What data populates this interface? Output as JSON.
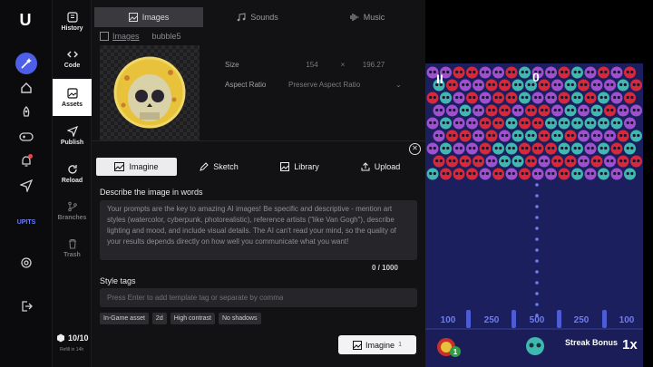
{
  "app": {
    "logo_text": "U"
  },
  "rail": {
    "items": [
      "magic-wand",
      "home",
      "rocket",
      "gamepad",
      "bell",
      "send",
      "settings",
      "logout"
    ],
    "upits_label": "UPITS"
  },
  "tools": [
    {
      "label": "History",
      "icon": "history-icon"
    },
    {
      "label": "Code",
      "icon": "code-icon"
    },
    {
      "label": "Assets",
      "icon": "image-icon",
      "active": true
    },
    {
      "label": "Publish",
      "icon": "send-icon"
    },
    {
      "label": "Reload",
      "icon": "reload-icon"
    },
    {
      "label": "Branches",
      "icon": "branch-icon"
    },
    {
      "label": "Trash",
      "icon": "trash-icon"
    }
  ],
  "credits": {
    "value": "10/10",
    "refill": "Refill in 14h"
  },
  "asset_panel": {
    "tabs": [
      {
        "label": "Images",
        "active": true
      },
      {
        "label": "Sounds"
      },
      {
        "label": "Music"
      }
    ],
    "breadcrumb": {
      "parent": "Images",
      "current": "bubble5"
    },
    "size_label": "Size",
    "width": "154",
    "times": "×",
    "height": "196.27",
    "aspect_label": "Aspect Ratio",
    "aspect_value": "Preserve Aspect Ratio"
  },
  "modal": {
    "tabs": [
      {
        "label": "Imagine",
        "active": true
      },
      {
        "label": "Sketch"
      },
      {
        "label": "Library"
      },
      {
        "label": "Upload"
      }
    ],
    "describe_label": "Describe the image in words",
    "describe_placeholder": "Your prompts are the key to amazing AI images! Be specific and descriptive - mention art styles (watercolor, cyberpunk, photorealistic), reference artists (\"like Van Gogh\"), describe lighting and mood, and include visual details. The AI can't read your mind, so the quality of your results depends directly on how well you communicate what you want!",
    "counter": "0 / 1000",
    "style_label": "Style tags",
    "tags_placeholder": "Press Enter to add template tag or separate by comma",
    "tags": [
      "In-Game asset",
      "2d",
      "High contrast",
      "No shadows"
    ],
    "generate_label": "Imagine",
    "generate_cost": "1"
  },
  "game": {
    "score": "0",
    "pause": "II",
    "slots": [
      "100",
      "250",
      "500",
      "250",
      "100"
    ],
    "streak_label": "Streak Bonus",
    "multiplier": "1x",
    "launcher_count": "1",
    "colors": {
      "field": "#1b1f5e",
      "red": "#d8283a",
      "purple": "#a14fd1",
      "teal": "#3fb8b0"
    }
  }
}
